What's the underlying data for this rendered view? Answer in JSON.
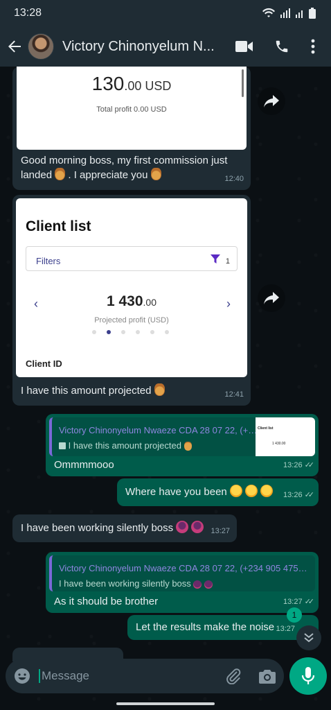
{
  "status_bar": {
    "time": "13:28"
  },
  "header": {
    "contact_name": "Victory Chinonyelum N..."
  },
  "messages": [
    {
      "id": "m1",
      "card": {
        "amount_main": "130",
        "amount_decimals": ".00 USD",
        "sub": "Total profit 0.00 USD"
      },
      "text_part1": "Good morning boss, my first commission just",
      "text_part2": "landed",
      "text_part3": ". I appreciate you",
      "time": "12:40"
    },
    {
      "id": "m2",
      "card": {
        "title": "Client list",
        "filters_label": "Filters",
        "filters_count": "1",
        "amount_main": "1 430",
        "amount_decimals": ".00",
        "sub": "Projected profit (USD)",
        "column_label": "Client ID"
      },
      "text": "I have this amount projected",
      "time": "12:41"
    },
    {
      "id": "m3",
      "quote_author": "Victory Chinonyelum Nwaeze CDA 28 07 22, (+234 9...",
      "quote_text": "I have this amount projected",
      "text": "Ommmmooo",
      "time": "13:26"
    },
    {
      "id": "m4",
      "text": "Where have you been",
      "time": "13:26"
    },
    {
      "id": "m5",
      "text": "I have been working silently boss",
      "time": "13:27"
    },
    {
      "id": "m6",
      "quote_author": "Victory Chinonyelum Nwaeze CDA 28 07 22, (+234 905 475 36...",
      "quote_text": "I have been working silently boss",
      "text": "As it should be brother",
      "time": "13:27"
    },
    {
      "id": "m7",
      "text": "Let the results make the noise",
      "time": "13:27"
    }
  ],
  "thumb": {
    "title": "Client list",
    "amount": "1 430.00"
  },
  "unread_count": "1",
  "input": {
    "placeholder": "Message"
  },
  "colors": {
    "incoming": "#1f2c34",
    "outgoing": "#005c4b",
    "accent": "#00a884"
  }
}
